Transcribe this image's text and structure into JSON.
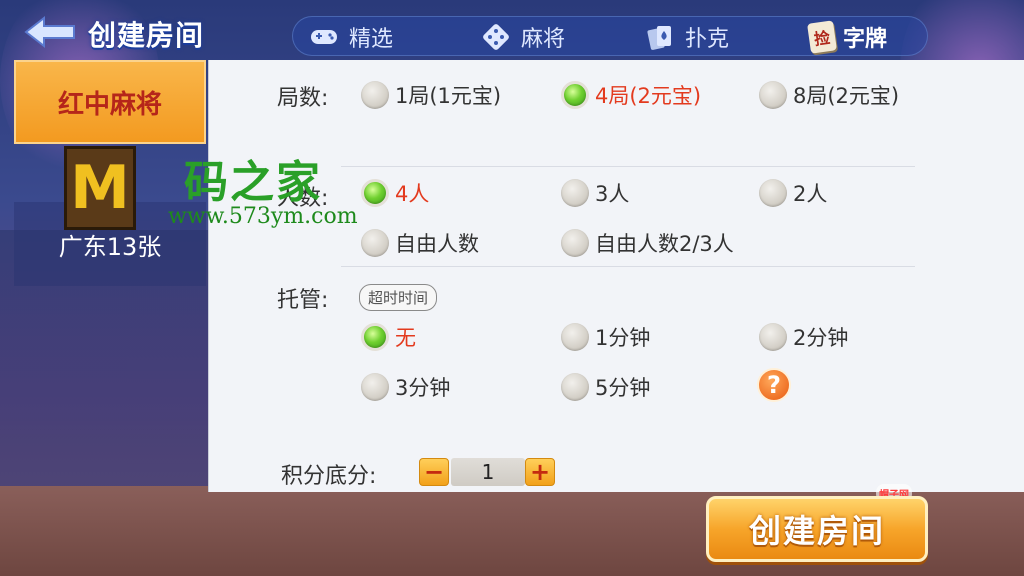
{
  "header": {
    "title": "创建房间",
    "tabs": [
      {
        "label": "精选",
        "icon": "gamepad-icon"
      },
      {
        "label": "麻将",
        "icon": "dice-icon"
      },
      {
        "label": "扑克",
        "icon": "cards-icon"
      },
      {
        "label": "字牌",
        "icon": "tile-icon",
        "icon_text": "捡",
        "active": true
      }
    ]
  },
  "sidebar": {
    "items": [
      {
        "label": "红中麻将",
        "active": true
      },
      {
        "label": "广东13张",
        "active": false
      }
    ]
  },
  "rounds": {
    "label": "局数:",
    "options": [
      {
        "label": "1局(1元宝)",
        "selected": false
      },
      {
        "label": "4局(2元宝)",
        "selected": true
      },
      {
        "label": "8局(2元宝)",
        "selected": false
      }
    ]
  },
  "players": {
    "label": "人数:",
    "options": [
      {
        "label": "4人",
        "selected": true
      },
      {
        "label": "3人",
        "selected": false
      },
      {
        "label": "2人",
        "selected": false
      },
      {
        "label": "自由人数",
        "selected": false
      },
      {
        "label": "自由人数2/3人",
        "selected": false
      }
    ]
  },
  "hosting": {
    "label": "托管:",
    "badge": "超时时间",
    "options": [
      {
        "label": "无",
        "selected": true
      },
      {
        "label": "1分钟",
        "selected": false
      },
      {
        "label": "2分钟",
        "selected": false
      },
      {
        "label": "3分钟",
        "selected": false
      },
      {
        "label": "5分钟",
        "selected": false
      }
    ],
    "help": "?"
  },
  "base_score": {
    "label": "积分底分:",
    "minus": "−",
    "value": "1",
    "plus": "+"
  },
  "create_button": "创建房间",
  "watermark": {
    "logo": "M",
    "title": "码之家",
    "url": "www.573ym.com"
  },
  "corner_logo": "帽子网",
  "colors": {
    "selected_text": "#e33a1e",
    "accent_orange": "#f39a20",
    "radio_on": "#70d030"
  }
}
